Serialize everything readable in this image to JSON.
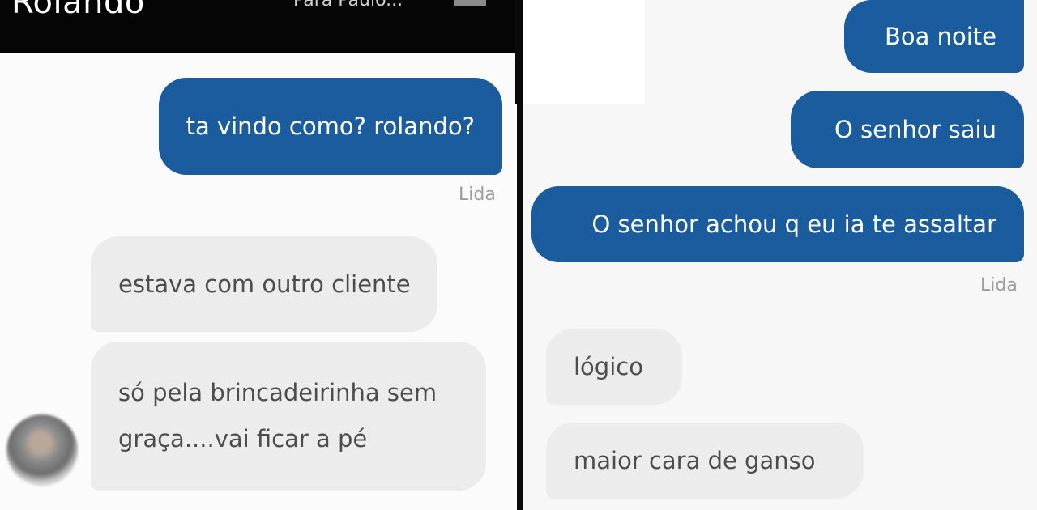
{
  "left_chat": {
    "contact_name": "Rolando",
    "header_subtitle": "Para Paulo...",
    "outgoing": [
      {
        "text": "ta vindo como? rolando?"
      }
    ],
    "read_label": "Lida",
    "incoming": [
      {
        "text": "estava com outro cliente"
      },
      {
        "line1": "só pela brincadeirinha sem",
        "line2": "graça....vai ficar a pé"
      }
    ]
  },
  "right_chat": {
    "outgoing": [
      {
        "text": "Boa noite"
      },
      {
        "text": "O senhor saiu"
      },
      {
        "text": "O senhor achou q eu ia te assaltar"
      }
    ],
    "read_label": "Lida",
    "incoming": [
      {
        "text": "lógico"
      },
      {
        "text": "maior cara de ganso"
      }
    ]
  },
  "colors": {
    "outgoing_bubble": "#1a5c9e",
    "incoming_bubble": "#ececec",
    "header": "#050505"
  }
}
